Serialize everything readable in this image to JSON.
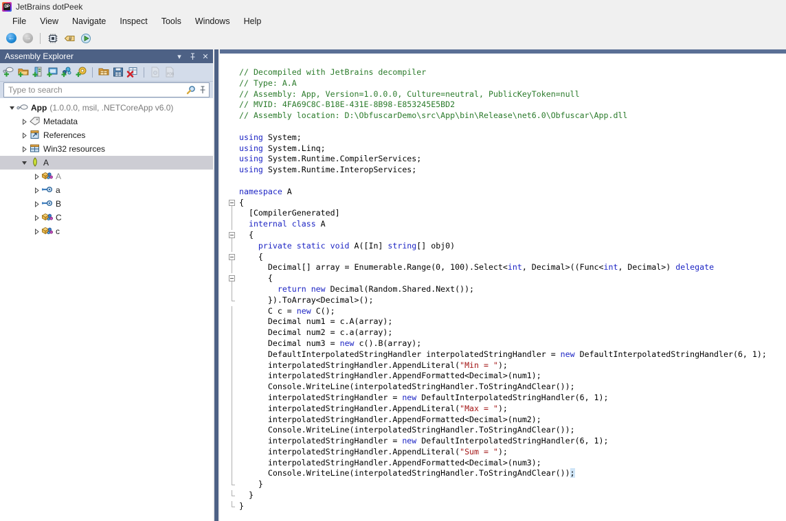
{
  "window": {
    "title": "JetBrains dotPeek",
    "logo_icon": "dotpeek-logo-icon"
  },
  "menubar": {
    "items": [
      {
        "label": "File"
      },
      {
        "label": "View"
      },
      {
        "label": "Navigate"
      },
      {
        "label": "Inspect"
      },
      {
        "label": "Tools"
      },
      {
        "label": "Windows"
      },
      {
        "label": "Help"
      }
    ]
  },
  "main_toolbar": {
    "buttons": [
      {
        "name": "navigate-back-button",
        "icon": "back-arrow-icon",
        "enabled": true
      },
      {
        "name": "navigate-forward-button",
        "icon": "forward-arrow-icon",
        "enabled": false
      },
      {
        "name": "metadata-view-button",
        "icon": "chip-icon",
        "enabled": true
      },
      {
        "name": "il-viewer-button",
        "icon": "tag-hash-icon",
        "enabled": true
      },
      {
        "name": "run-button",
        "icon": "green-play-globe-icon",
        "enabled": true
      }
    ]
  },
  "assembly_explorer": {
    "title": "Assembly Explorer",
    "header_buttons": [
      {
        "name": "panel-options-button",
        "icon": "chevron-down-icon",
        "glyph": "▾"
      },
      {
        "name": "panel-pin-button",
        "icon": "pin-icon",
        "glyph": "⚲"
      },
      {
        "name": "panel-close-button",
        "icon": "close-icon",
        "glyph": "✕"
      }
    ],
    "toolbar": [
      {
        "name": "open-assembly-button",
        "icon": "open-assembly-plus-icon"
      },
      {
        "name": "add-folder-button",
        "icon": "folder-plus-icon"
      },
      {
        "name": "add-from-gac-button",
        "icon": "gac-plus-icon"
      },
      {
        "name": "add-process-button",
        "icon": "process-plus-icon"
      },
      {
        "name": "add-package-button",
        "icon": "package-plus-icon"
      },
      {
        "name": "add-nuget-button",
        "icon": "nuget-plus-icon"
      },
      {
        "name": "open-assembly-list-button",
        "icon": "assembly-list-icon"
      },
      {
        "name": "save-assembly-list-button",
        "icon": "save-list-icon"
      },
      {
        "name": "close-assembly-list-button",
        "icon": "close-list-red-x-icon"
      },
      {
        "name": "show-xml-doc-button",
        "icon": "xml-doc-icon",
        "enabled": false
      },
      {
        "name": "show-pdb-button",
        "icon": "pdb-icon",
        "enabled": false
      }
    ],
    "search": {
      "placeholder": "Type to search",
      "value": "",
      "buttons": [
        {
          "name": "search-options-icon",
          "icon": "magnifier-icon"
        },
        {
          "name": "search-pin-icon",
          "icon": "pin-icon",
          "glyph": "⚲"
        }
      ]
    },
    "tree": [
      {
        "indent": 0,
        "twisty": "expanded",
        "icon": "assembly-icon",
        "label": "App",
        "meta": "(1.0.0.0, msil, .NETCoreApp v6.0)",
        "selected": false,
        "dim": false
      },
      {
        "indent": 1,
        "twisty": "collapsed",
        "icon": "metadata-tag-icon",
        "label": "Metadata",
        "meta": "",
        "selected": false,
        "dim": false
      },
      {
        "indent": 1,
        "twisty": "collapsed",
        "icon": "references-icon",
        "label": "References",
        "meta": "",
        "selected": false,
        "dim": false
      },
      {
        "indent": 1,
        "twisty": "collapsed",
        "icon": "win32-resources-icon",
        "label": "Win32 resources",
        "meta": "",
        "selected": false,
        "dim": false
      },
      {
        "indent": 1,
        "twisty": "expanded",
        "icon": "namespace-icon",
        "label": "A",
        "meta": "",
        "selected": true,
        "dim": false
      },
      {
        "indent": 2,
        "twisty": "collapsed",
        "icon": "class-internal-icon",
        "label": "A",
        "meta": "",
        "selected": false,
        "dim": true
      },
      {
        "indent": 2,
        "twisty": "collapsed",
        "icon": "interface-icon",
        "label": "a",
        "meta": "",
        "selected": false,
        "dim": false
      },
      {
        "indent": 2,
        "twisty": "collapsed",
        "icon": "interface-icon",
        "label": "B",
        "meta": "",
        "selected": false,
        "dim": false
      },
      {
        "indent": 2,
        "twisty": "collapsed",
        "icon": "class-icon",
        "label": "C",
        "meta": "",
        "selected": false,
        "dim": false
      },
      {
        "indent": 2,
        "twisty": "collapsed",
        "icon": "class-icon",
        "label": "c",
        "meta": "",
        "selected": false,
        "dim": false
      }
    ]
  },
  "editor": {
    "code_lines": [
      {
        "fold": "none",
        "tokens": [
          {
            "t": "// Decompiled with JetBrains decompiler",
            "c": "cmt"
          }
        ]
      },
      {
        "fold": "none",
        "tokens": [
          {
            "t": "// Type: A.A",
            "c": "cmt"
          }
        ]
      },
      {
        "fold": "none",
        "tokens": [
          {
            "t": "// Assembly: App, Version=1.0.0.0, Culture=neutral, PublicKeyToken=null",
            "c": "cmt"
          }
        ]
      },
      {
        "fold": "none",
        "tokens": [
          {
            "t": "// MVID: 4FA69C8C-B18E-431E-8B98-E853245E5BD2",
            "c": "cmt"
          }
        ]
      },
      {
        "fold": "none",
        "tokens": [
          {
            "t": "// Assembly location: D:\\ObfuscarDemo\\src\\App\\bin\\Release\\net6.0\\Obfuscar\\App.dll",
            "c": "cmt"
          }
        ]
      },
      {
        "fold": "none",
        "tokens": [
          {
            "t": "",
            "c": ""
          }
        ]
      },
      {
        "fold": "none",
        "tokens": [
          {
            "t": "using",
            "c": "kw"
          },
          {
            "t": " System;",
            "c": ""
          }
        ]
      },
      {
        "fold": "none",
        "tokens": [
          {
            "t": "using",
            "c": "kw"
          },
          {
            "t": " System.Linq;",
            "c": ""
          }
        ]
      },
      {
        "fold": "none",
        "tokens": [
          {
            "t": "using",
            "c": "kw"
          },
          {
            "t": " System.Runtime.CompilerServices;",
            "c": ""
          }
        ]
      },
      {
        "fold": "none",
        "tokens": [
          {
            "t": "using",
            "c": "kw"
          },
          {
            "t": " System.Runtime.InteropServices;",
            "c": ""
          }
        ]
      },
      {
        "fold": "none",
        "tokens": [
          {
            "t": "",
            "c": ""
          }
        ]
      },
      {
        "fold": "none",
        "tokens": [
          {
            "t": "namespace",
            "c": "kw"
          },
          {
            "t": " A",
            "c": ""
          }
        ]
      },
      {
        "fold": "box",
        "tokens": [
          {
            "t": "{",
            "c": ""
          }
        ]
      },
      {
        "fold": "line",
        "tokens": [
          {
            "t": "  [CompilerGenerated]",
            "c": ""
          }
        ]
      },
      {
        "fold": "line",
        "tokens": [
          {
            "t": "  ",
            "c": ""
          },
          {
            "t": "internal class",
            "c": "kw"
          },
          {
            "t": " A",
            "c": ""
          }
        ]
      },
      {
        "fold": "box",
        "tokens": [
          {
            "t": "  {",
            "c": ""
          }
        ]
      },
      {
        "fold": "line",
        "tokens": [
          {
            "t": "    ",
            "c": ""
          },
          {
            "t": "private static void",
            "c": "kw"
          },
          {
            "t": " A([In] ",
            "c": ""
          },
          {
            "t": "string",
            "c": "kw"
          },
          {
            "t": "[] obj0)",
            "c": ""
          }
        ]
      },
      {
        "fold": "box",
        "tokens": [
          {
            "t": "    {",
            "c": ""
          }
        ]
      },
      {
        "fold": "line",
        "tokens": [
          {
            "t": "      Decimal[] array = Enumerable.Range(0, 100).Select<",
            "c": ""
          },
          {
            "t": "int",
            "c": "kw"
          },
          {
            "t": ", Decimal>((Func<",
            "c": ""
          },
          {
            "t": "int",
            "c": "kw"
          },
          {
            "t": ", Decimal>) ",
            "c": ""
          },
          {
            "t": "delegate",
            "c": "kw"
          }
        ]
      },
      {
        "fold": "box",
        "tokens": [
          {
            "t": "      {",
            "c": ""
          }
        ]
      },
      {
        "fold": "line",
        "tokens": [
          {
            "t": "        ",
            "c": ""
          },
          {
            "t": "return new",
            "c": "kw"
          },
          {
            "t": " Decimal(Random.Shared.Next());",
            "c": ""
          }
        ]
      },
      {
        "fold": "end",
        "tokens": [
          {
            "t": "      }).ToArray<Decimal>();",
            "c": ""
          }
        ]
      },
      {
        "fold": "line",
        "tokens": [
          {
            "t": "      C c = ",
            "c": ""
          },
          {
            "t": "new",
            "c": "kw"
          },
          {
            "t": " C();",
            "c": ""
          }
        ]
      },
      {
        "fold": "line",
        "tokens": [
          {
            "t": "      Decimal num1 = c.A(array);",
            "c": ""
          }
        ]
      },
      {
        "fold": "line",
        "tokens": [
          {
            "t": "      Decimal num2 = c.a(array);",
            "c": ""
          }
        ]
      },
      {
        "fold": "line",
        "tokens": [
          {
            "t": "      Decimal num3 = ",
            "c": ""
          },
          {
            "t": "new",
            "c": "kw"
          },
          {
            "t": " c().B(array);",
            "c": ""
          }
        ]
      },
      {
        "fold": "line",
        "tokens": [
          {
            "t": "      DefaultInterpolatedStringHandler interpolatedStringHandler = ",
            "c": ""
          },
          {
            "t": "new",
            "c": "kw"
          },
          {
            "t": " DefaultInterpolatedStringHandler(6, 1);",
            "c": ""
          }
        ]
      },
      {
        "fold": "line",
        "tokens": [
          {
            "t": "      interpolatedStringHandler.AppendLiteral(",
            "c": ""
          },
          {
            "t": "\"Min = \"",
            "c": "str"
          },
          {
            "t": ");",
            "c": ""
          }
        ]
      },
      {
        "fold": "line",
        "tokens": [
          {
            "t": "      interpolatedStringHandler.AppendFormatted<Decimal>(num1);",
            "c": ""
          }
        ]
      },
      {
        "fold": "line",
        "tokens": [
          {
            "t": "      Console.WriteLine(interpolatedStringHandler.ToStringAndClear());",
            "c": ""
          }
        ]
      },
      {
        "fold": "line",
        "tokens": [
          {
            "t": "      interpolatedStringHandler = ",
            "c": ""
          },
          {
            "t": "new",
            "c": "kw"
          },
          {
            "t": " DefaultInterpolatedStringHandler(6, 1);",
            "c": ""
          }
        ]
      },
      {
        "fold": "line",
        "tokens": [
          {
            "t": "      interpolatedStringHandler.AppendLiteral(",
            "c": ""
          },
          {
            "t": "\"Max = \"",
            "c": "str"
          },
          {
            "t": ");",
            "c": ""
          }
        ]
      },
      {
        "fold": "line",
        "tokens": [
          {
            "t": "      interpolatedStringHandler.AppendFormatted<Decimal>(num2);",
            "c": ""
          }
        ]
      },
      {
        "fold": "line",
        "tokens": [
          {
            "t": "      Console.WriteLine(interpolatedStringHandler.ToStringAndClear());",
            "c": ""
          }
        ]
      },
      {
        "fold": "line",
        "tokens": [
          {
            "t": "      interpolatedStringHandler = ",
            "c": ""
          },
          {
            "t": "new",
            "c": "kw"
          },
          {
            "t": " DefaultInterpolatedStringHandler(6, 1);",
            "c": ""
          }
        ]
      },
      {
        "fold": "line",
        "tokens": [
          {
            "t": "      interpolatedStringHandler.AppendLiteral(",
            "c": ""
          },
          {
            "t": "\"Sum = \"",
            "c": "str"
          },
          {
            "t": ");",
            "c": ""
          }
        ]
      },
      {
        "fold": "line",
        "tokens": [
          {
            "t": "      interpolatedStringHandler.AppendFormatted<Decimal>(num3);",
            "c": ""
          }
        ]
      },
      {
        "fold": "line",
        "tokens": [
          {
            "t": "      Console.WriteLine(interpolatedStringHandler.ToStringAndClear())",
            "c": ""
          },
          {
            "t": ";",
            "c": "cursel"
          }
        ]
      },
      {
        "fold": "end",
        "tokens": [
          {
            "t": "    }",
            "c": ""
          }
        ]
      },
      {
        "fold": "end",
        "tokens": [
          {
            "t": "  }",
            "c": ""
          }
        ]
      },
      {
        "fold": "end",
        "tokens": [
          {
            "t": "}",
            "c": ""
          }
        ]
      }
    ]
  },
  "colors": {
    "panel_header_bg": "#4d6185",
    "panel_toolbar_bg": "#d3dcea",
    "editor_bg": "#ffffff",
    "comment": "#2a7a2a",
    "keyword": "#1d25c4",
    "string": "#a31515",
    "selection": "#cfe5f7",
    "tree_selected_bg": "#cdcdd4",
    "chrome_bg": "#f0f0f0"
  }
}
